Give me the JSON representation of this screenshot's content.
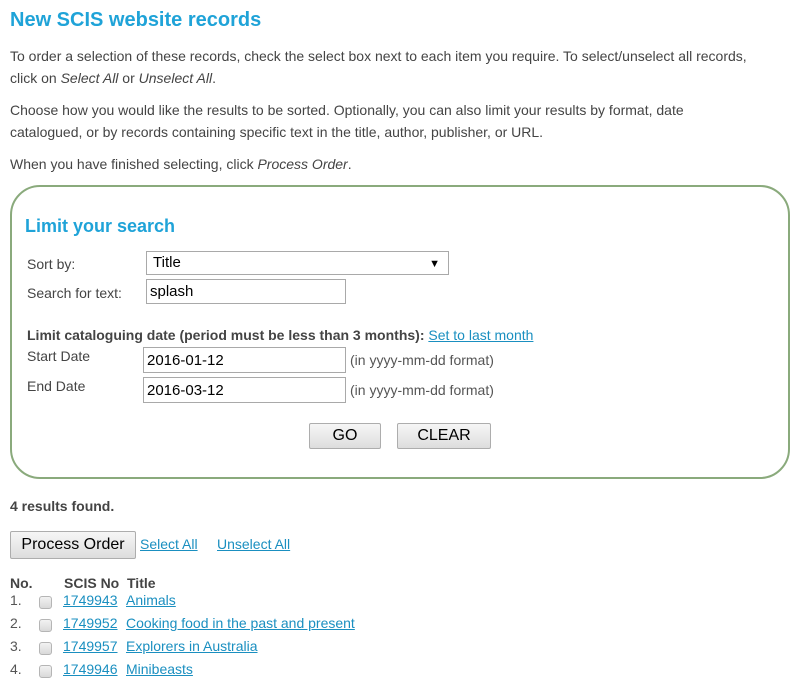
{
  "page": {
    "title": "New SCIS website records",
    "intro1_a": "To order a selection of these records, check the select box next to each item you require. To select/unselect all records,",
    "intro1_b_pre": "click on ",
    "intro1_b_em1": "Select All",
    "intro1_b_mid": " or ",
    "intro1_b_em2": "Unselect All",
    "intro1_b_post": ".",
    "intro2_a": "Choose how you would like the results to be sorted. Optionally, you can also limit your results by format, date",
    "intro2_b": "catalogued, or by records containing specific text in the title, author, publisher, or URL.",
    "intro3_pre": "When you have finished selecting, click ",
    "intro3_em": "Process Order",
    "intro3_post": "."
  },
  "search_panel": {
    "title": "Limit your search",
    "sort_label": "Sort by:",
    "sort_value": "Title",
    "sort_arrow_icon": "▼",
    "text_label": "Search for text:",
    "text_value": "splash",
    "date_heading": "Limit cataloguing date (period must be less than 3 months):",
    "set_last_month_link": "Set to last month",
    "start_label": "Start Date",
    "start_value": "2016-01-12",
    "end_label": "End Date",
    "end_value": "2016-03-12",
    "date_hint": "(in yyyy-mm-dd format)",
    "go_label": "GO",
    "clear_label": "CLEAR"
  },
  "results": {
    "count_text": "4 results found.",
    "process_order_label": "Process Order",
    "select_all_label": "Select All",
    "unselect_all_label": "Unselect All",
    "columns": [
      "No.",
      "SCIS No",
      "Title"
    ],
    "rows": [
      {
        "no": "1.",
        "scis": "1749943",
        "title": "Animals",
        "checked": false
      },
      {
        "no": "2.",
        "scis": "1749952",
        "title": "Cooking food in the past and present",
        "checked": false
      },
      {
        "no": "3.",
        "scis": "1749957",
        "title": "Explorers in Australia",
        "checked": false
      },
      {
        "no": "4.",
        "scis": "1749946",
        "title": "Minibeasts",
        "checked": false
      }
    ]
  },
  "colors": {
    "heading": "#1fa3d8",
    "link": "#1a8fc0",
    "panel_border": "#8aaa7c"
  }
}
